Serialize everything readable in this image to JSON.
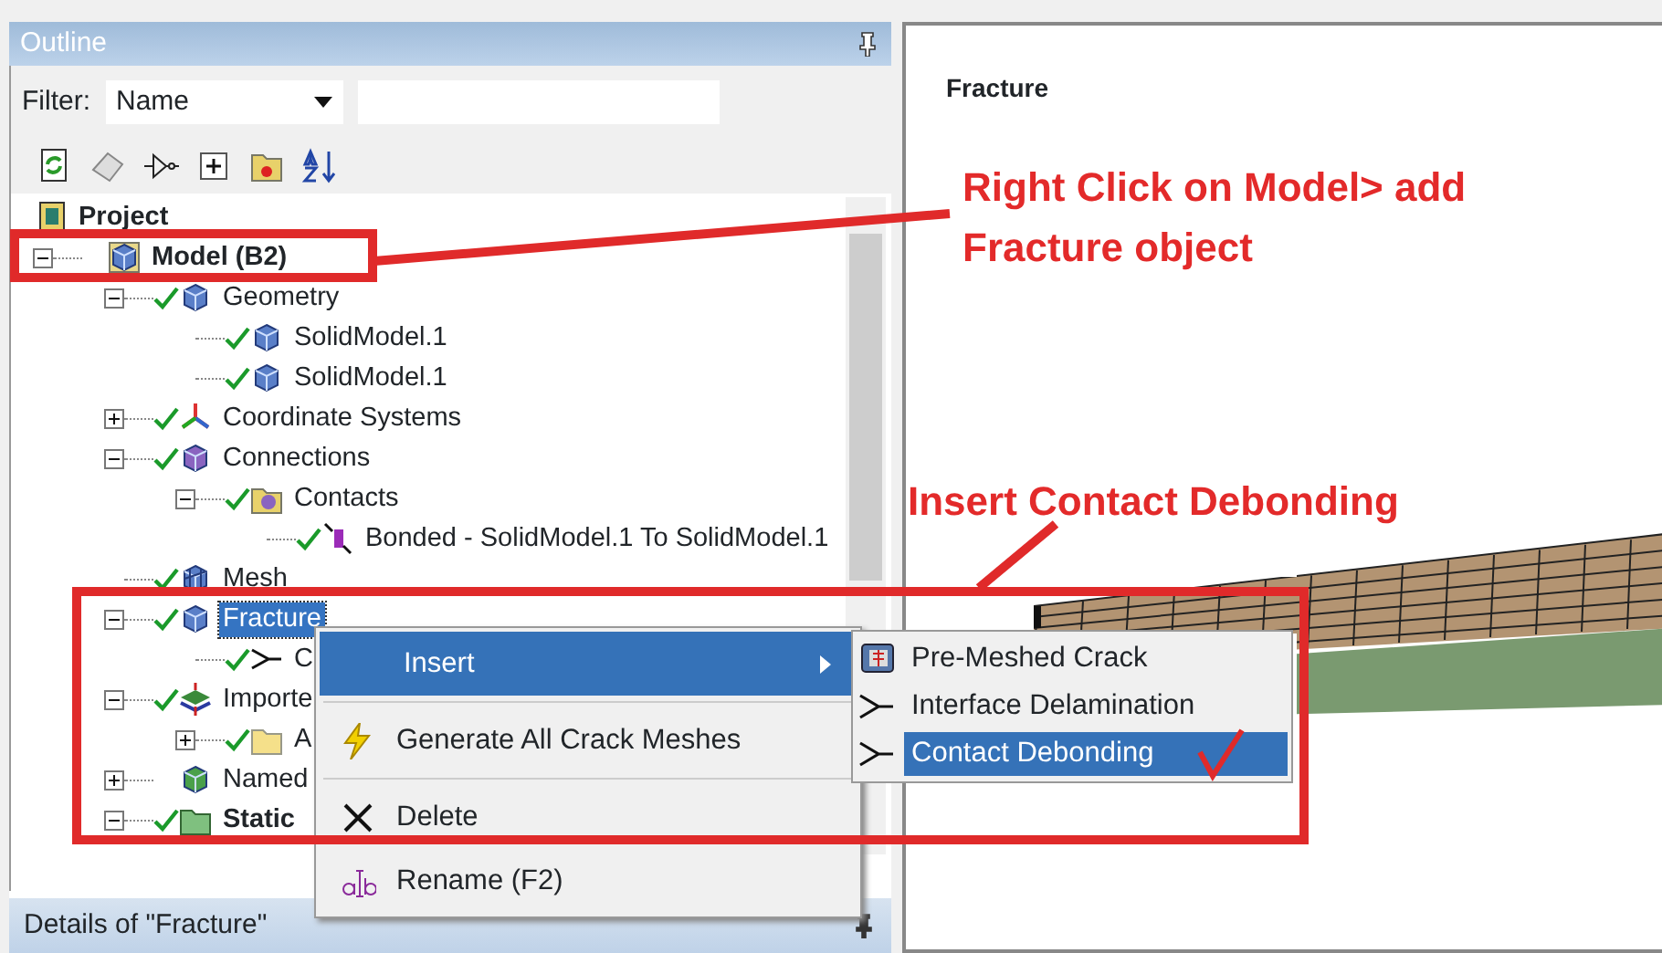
{
  "outline": {
    "title": "Outline",
    "filter_label": "Filter:",
    "filter_value": "Name"
  },
  "tree": [
    {
      "label": "Project",
      "kind": "project",
      "selected": false,
      "children": [
        {
          "label": "Model (B2)",
          "kind": "model",
          "expanded": true,
          "checked": false,
          "selected": false,
          "children": [
            {
              "label": "Geometry",
              "kind": "geometry",
              "expanded": true,
              "checked": true,
              "selected": false,
              "children": [
                {
                  "label": "SolidModel.1",
                  "kind": "body",
                  "checked": true,
                  "selected": false
                },
                {
                  "label": "SolidModel.1",
                  "kind": "body",
                  "checked": true,
                  "selected": false
                }
              ]
            },
            {
              "label": "Coordinate Systems",
              "kind": "coordinates",
              "expanded": false,
              "checked": true,
              "selected": false
            },
            {
              "label": "Connections",
              "kind": "connections",
              "expanded": true,
              "checked": true,
              "selected": false,
              "children": [
                {
                  "label": "Contacts",
                  "kind": "contacts",
                  "expanded": true,
                  "checked": true,
                  "selected": false,
                  "children": [
                    {
                      "label": "Bonded - SolidModel.1 To SolidModel.1",
                      "kind": "contact",
                      "checked": true,
                      "selected": false
                    }
                  ]
                }
              ]
            },
            {
              "label": "Mesh",
              "kind": "mesh",
              "checked": true,
              "selected": false
            },
            {
              "label": "Fracture",
              "kind": "fracture",
              "expanded": true,
              "checked": true,
              "selected": true,
              "children": [
                {
                  "label": "C",
                  "kind": "crack",
                  "checked": true,
                  "selected": false
                }
              ]
            },
            {
              "label": "Importe",
              "kind": "imported",
              "expanded": true,
              "checked": true,
              "selected": false,
              "children": [
                {
                  "label": "A",
                  "kind": "folder",
                  "expanded": false,
                  "checked": true,
                  "selected": false
                }
              ]
            },
            {
              "label": "Named",
              "kind": "named",
              "expanded": false,
              "checked": false,
              "selected": false
            },
            {
              "label": "Static",
              "kind": "analysis",
              "expanded": true,
              "checked": true,
              "selected": false
            }
          ]
        }
      ]
    }
  ],
  "details": {
    "title": "Details of \"Fracture\""
  },
  "context_menu": {
    "groups": [
      [
        {
          "label": "Insert",
          "kind": "insert",
          "selected": true
        }
      ],
      [
        {
          "label": "Generate All Crack Meshes",
          "kind": "generate",
          "selected": false
        }
      ],
      [
        {
          "label": "Delete",
          "kind": "delete",
          "selected": false
        },
        {
          "label": "Rename (F2)",
          "kind": "rename",
          "selected": false
        }
      ]
    ]
  },
  "submenu": [
    {
      "label": "Pre-Meshed Crack",
      "kind": "premeshed",
      "selected": false
    },
    {
      "label": "Interface Delamination",
      "kind": "delamination",
      "selected": false
    },
    {
      "label": "Contact Debonding",
      "kind": "debonding",
      "selected": true
    }
  ],
  "viewport": {
    "title": "Fracture"
  },
  "annotations": [
    {
      "text": "Right Click on Model> add Fracture object"
    },
    {
      "text": "Insert Contact Debonding"
    }
  ]
}
